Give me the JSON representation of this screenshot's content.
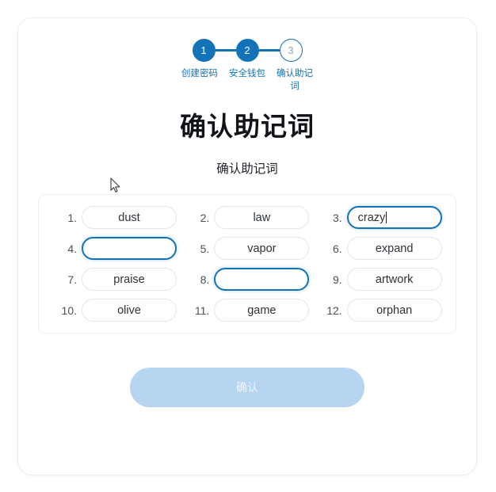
{
  "stepper": {
    "steps": [
      {
        "number": "1",
        "label": "创建密码",
        "state": "done"
      },
      {
        "number": "2",
        "label": "安全钱包",
        "state": "done"
      },
      {
        "number": "3",
        "label": "确认助记词",
        "state": "todo"
      }
    ],
    "accent_color": "#1273b8"
  },
  "heading": {
    "title": "确认助记词",
    "subtitle": "确认助记词"
  },
  "mnemonic": {
    "fields": [
      {
        "index": "1.",
        "value": "dust",
        "state": "filled"
      },
      {
        "index": "2.",
        "value": "law",
        "state": "filled"
      },
      {
        "index": "3.",
        "value": "crazy",
        "state": "active"
      },
      {
        "index": "4.",
        "value": "",
        "state": "blank"
      },
      {
        "index": "5.",
        "value": "vapor",
        "state": "filled"
      },
      {
        "index": "6.",
        "value": "expand",
        "state": "filled"
      },
      {
        "index": "7.",
        "value": "praise",
        "state": "filled"
      },
      {
        "index": "8.",
        "value": "",
        "state": "blank"
      },
      {
        "index": "9.",
        "value": "artwork",
        "state": "filled"
      },
      {
        "index": "10.",
        "value": "olive",
        "state": "filled"
      },
      {
        "index": "11.",
        "value": "game",
        "state": "filled"
      },
      {
        "index": "12.",
        "value": "orphan",
        "state": "filled"
      }
    ]
  },
  "actions": {
    "confirm_label": "确认",
    "confirm_disabled_color": "#b7d5f0"
  }
}
